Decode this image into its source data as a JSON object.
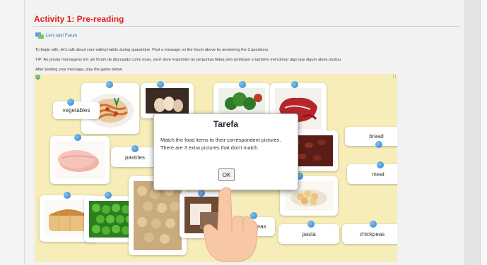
{
  "activity": {
    "title": "Activity 1: Pre-reading",
    "forum_link": "Let's talk! Forum",
    "para1": "To begin with, let's talk about your eating habits during quarantine. Post a message on the forum above by answering the 3 questions.",
    "para2": "TIP: Ao postar mensagens em um fórum de discussão como esse, você deve responder às perguntas feitas pelo professor e também mencionar algo que algum aluno postou.",
    "para3": "After posting your message, play the game below."
  },
  "game": {
    "corner_right": "↑↓",
    "labels": {
      "vegetables": "vegetables",
      "pastries": "pastries",
      "bread": "bread",
      "meat": "meat",
      "green_peas": "green peas",
      "pasta": "pasta",
      "chickpeas": "chickpeas"
    },
    "pictures": [
      "pasta",
      "eggs",
      "broccoli",
      "meat",
      "ham",
      "beans",
      "bread",
      "peas",
      "chickpeas",
      "cookies",
      "pastries"
    ]
  },
  "dialog": {
    "title": "Tarefa",
    "text": "Match the food items to their correspondent pictures. There are 3 extra pictures that don't match.",
    "ok_label": "OK"
  },
  "colors": {
    "title_red": "#e0201a",
    "link_blue": "#2a6fb8",
    "pin_blue": "#2b7fd0",
    "game_bg": "#f6edb9",
    "hand_skin": "#f7c7a6"
  },
  "icons": [
    "forum-icon",
    "game-header-icon",
    "pointing-hand-icon"
  ]
}
